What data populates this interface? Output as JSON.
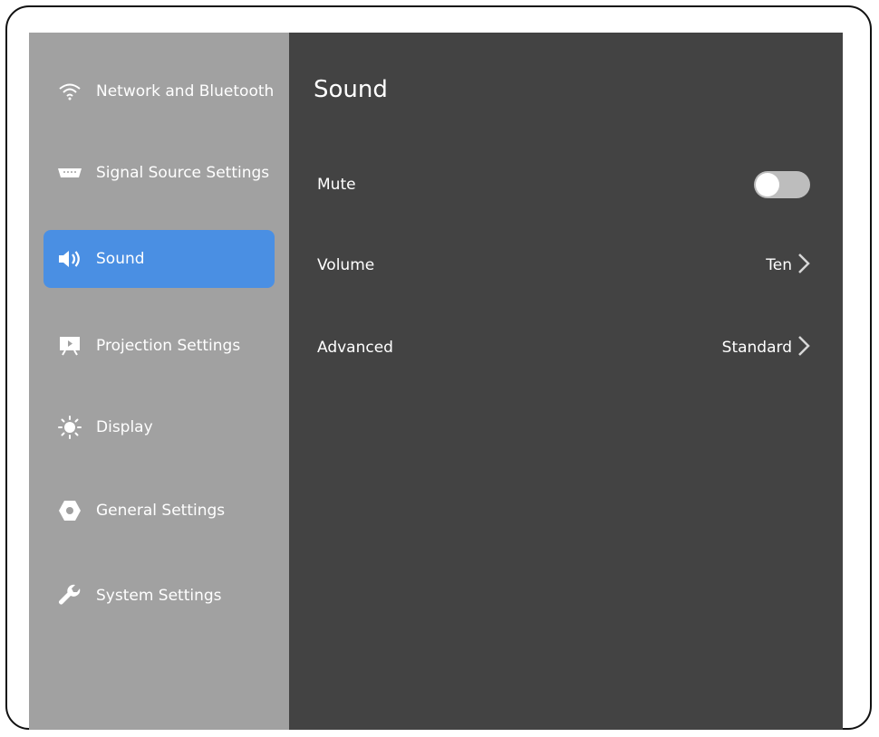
{
  "sidebar": {
    "items": [
      {
        "label": "Network and Bluetooth",
        "icon": "wifi-icon"
      },
      {
        "label": "Signal Source Settings",
        "icon": "input-port-icon"
      },
      {
        "label": "Sound",
        "icon": "speaker-icon",
        "active": true
      },
      {
        "label": "Projection Settings",
        "icon": "projection-icon"
      },
      {
        "label": "Display",
        "icon": "brightness-icon"
      },
      {
        "label": "General Settings",
        "icon": "general-settings-icon"
      },
      {
        "label": "System Settings",
        "icon": "wrench-icon"
      }
    ]
  },
  "main": {
    "title": "Sound",
    "rows": [
      {
        "label": "Mute",
        "control": "toggle",
        "toggle_on": false
      },
      {
        "label": "Volume",
        "value": "Ten",
        "control": "chevron"
      },
      {
        "label": "Advanced",
        "value": "Standard",
        "control": "chevron"
      }
    ]
  },
  "colors": {
    "sidebar_bg": "#a1a1a1",
    "content_bg": "#434343",
    "active_item": "#4a8fe3",
    "text": "#ffffff"
  }
}
